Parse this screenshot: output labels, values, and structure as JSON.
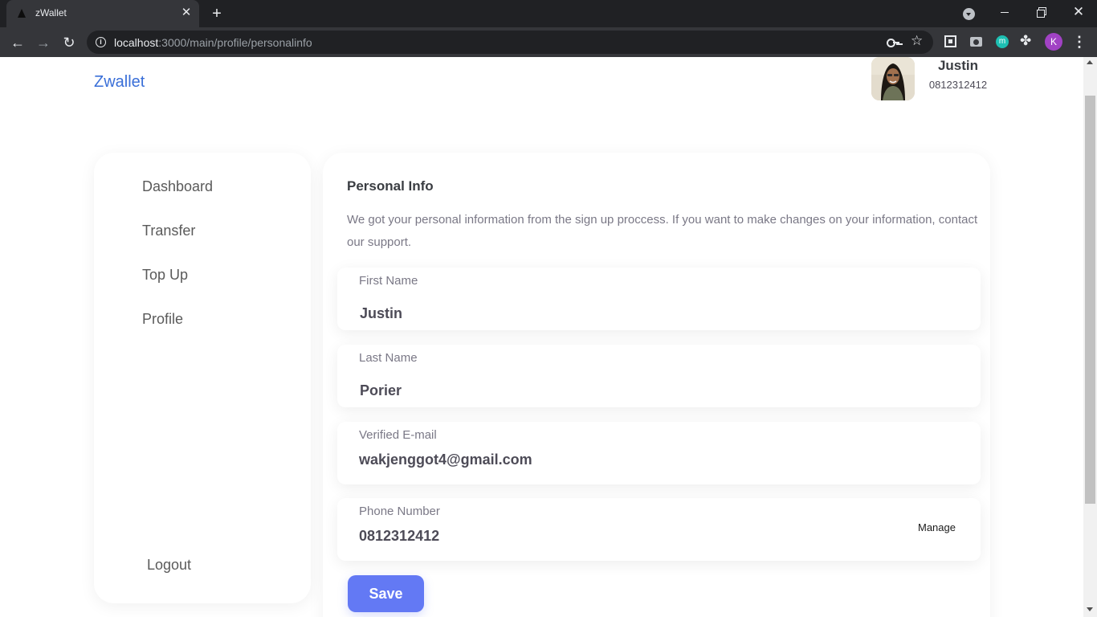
{
  "browser": {
    "tab_title": "zWallet",
    "url_host": "localhost",
    "url_path": ":3000/main/profile/personalinfo",
    "profile_initial": "K",
    "extension_m_label": "m"
  },
  "header": {
    "brand": "Zwallet",
    "user": {
      "name": "Justin",
      "phone": "0812312412"
    }
  },
  "sidebar": {
    "items": [
      {
        "label": "Dashboard"
      },
      {
        "label": "Transfer"
      },
      {
        "label": "Top Up"
      },
      {
        "label": "Profile"
      }
    ],
    "logout_label": "Logout"
  },
  "personal_info": {
    "title": "Personal Info",
    "description": "We got your personal information from the sign up proccess. If you want to make changes on your information, contact our support.",
    "fields": [
      {
        "label": "First Name",
        "value": "Justin"
      },
      {
        "label": "Last Name",
        "value": "Porier"
      },
      {
        "label": "Verified E-mail",
        "value": "wakjenggot4@gmail.com"
      },
      {
        "label": "Phone Number",
        "value": "0812312412",
        "action": "Manage"
      }
    ],
    "save_label": "Save"
  },
  "colors": {
    "brand": "#3a6fd8",
    "primary_button": "#6379f4",
    "chrome_dark": "#202124",
    "chrome_toolbar": "#35363a"
  }
}
